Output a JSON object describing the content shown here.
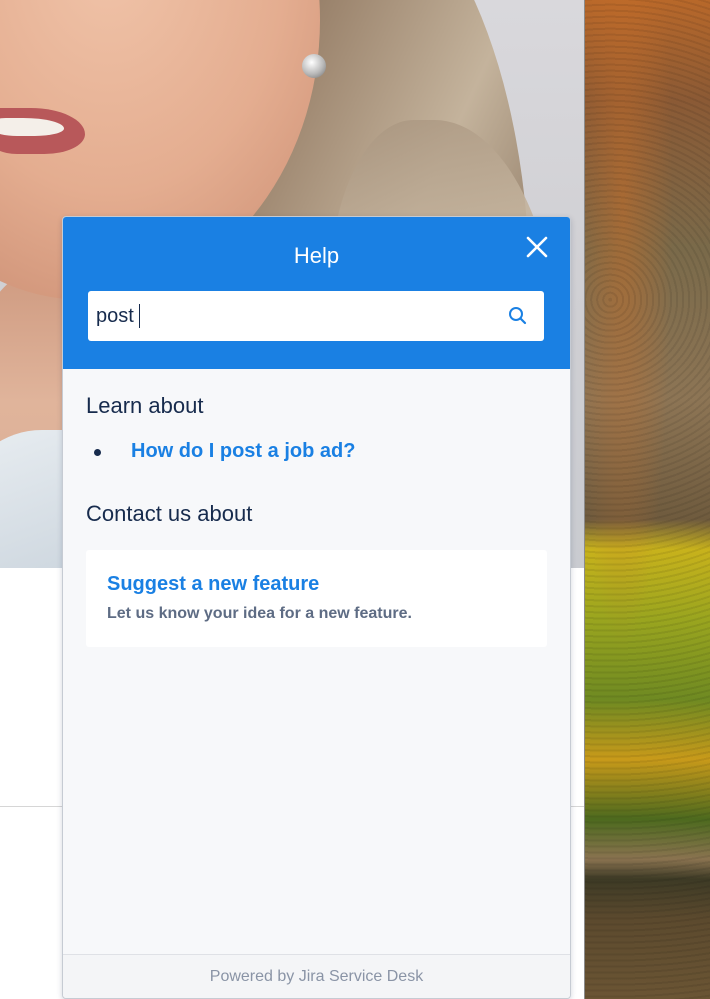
{
  "widget": {
    "title": "Help",
    "close_icon": "close-icon",
    "search": {
      "value": "post",
      "icon": "search-icon"
    },
    "learn_section": {
      "heading": "Learn about",
      "articles": [
        {
          "label": "How do I post a job ad?"
        }
      ]
    },
    "contact_section": {
      "heading": "Contact us about",
      "request_types": [
        {
          "title": "Suggest a new feature",
          "description": "Let us know your idea for a new feature."
        }
      ]
    },
    "footer": "Powered by Jira Service Desk"
  },
  "colors": {
    "header": "#1a80e3",
    "link": "#1a80e3",
    "heading_text": "#172b4d",
    "description_text": "#5e6c84",
    "footer_text": "#8a94a6",
    "panel_background": "#f7f8fa"
  }
}
